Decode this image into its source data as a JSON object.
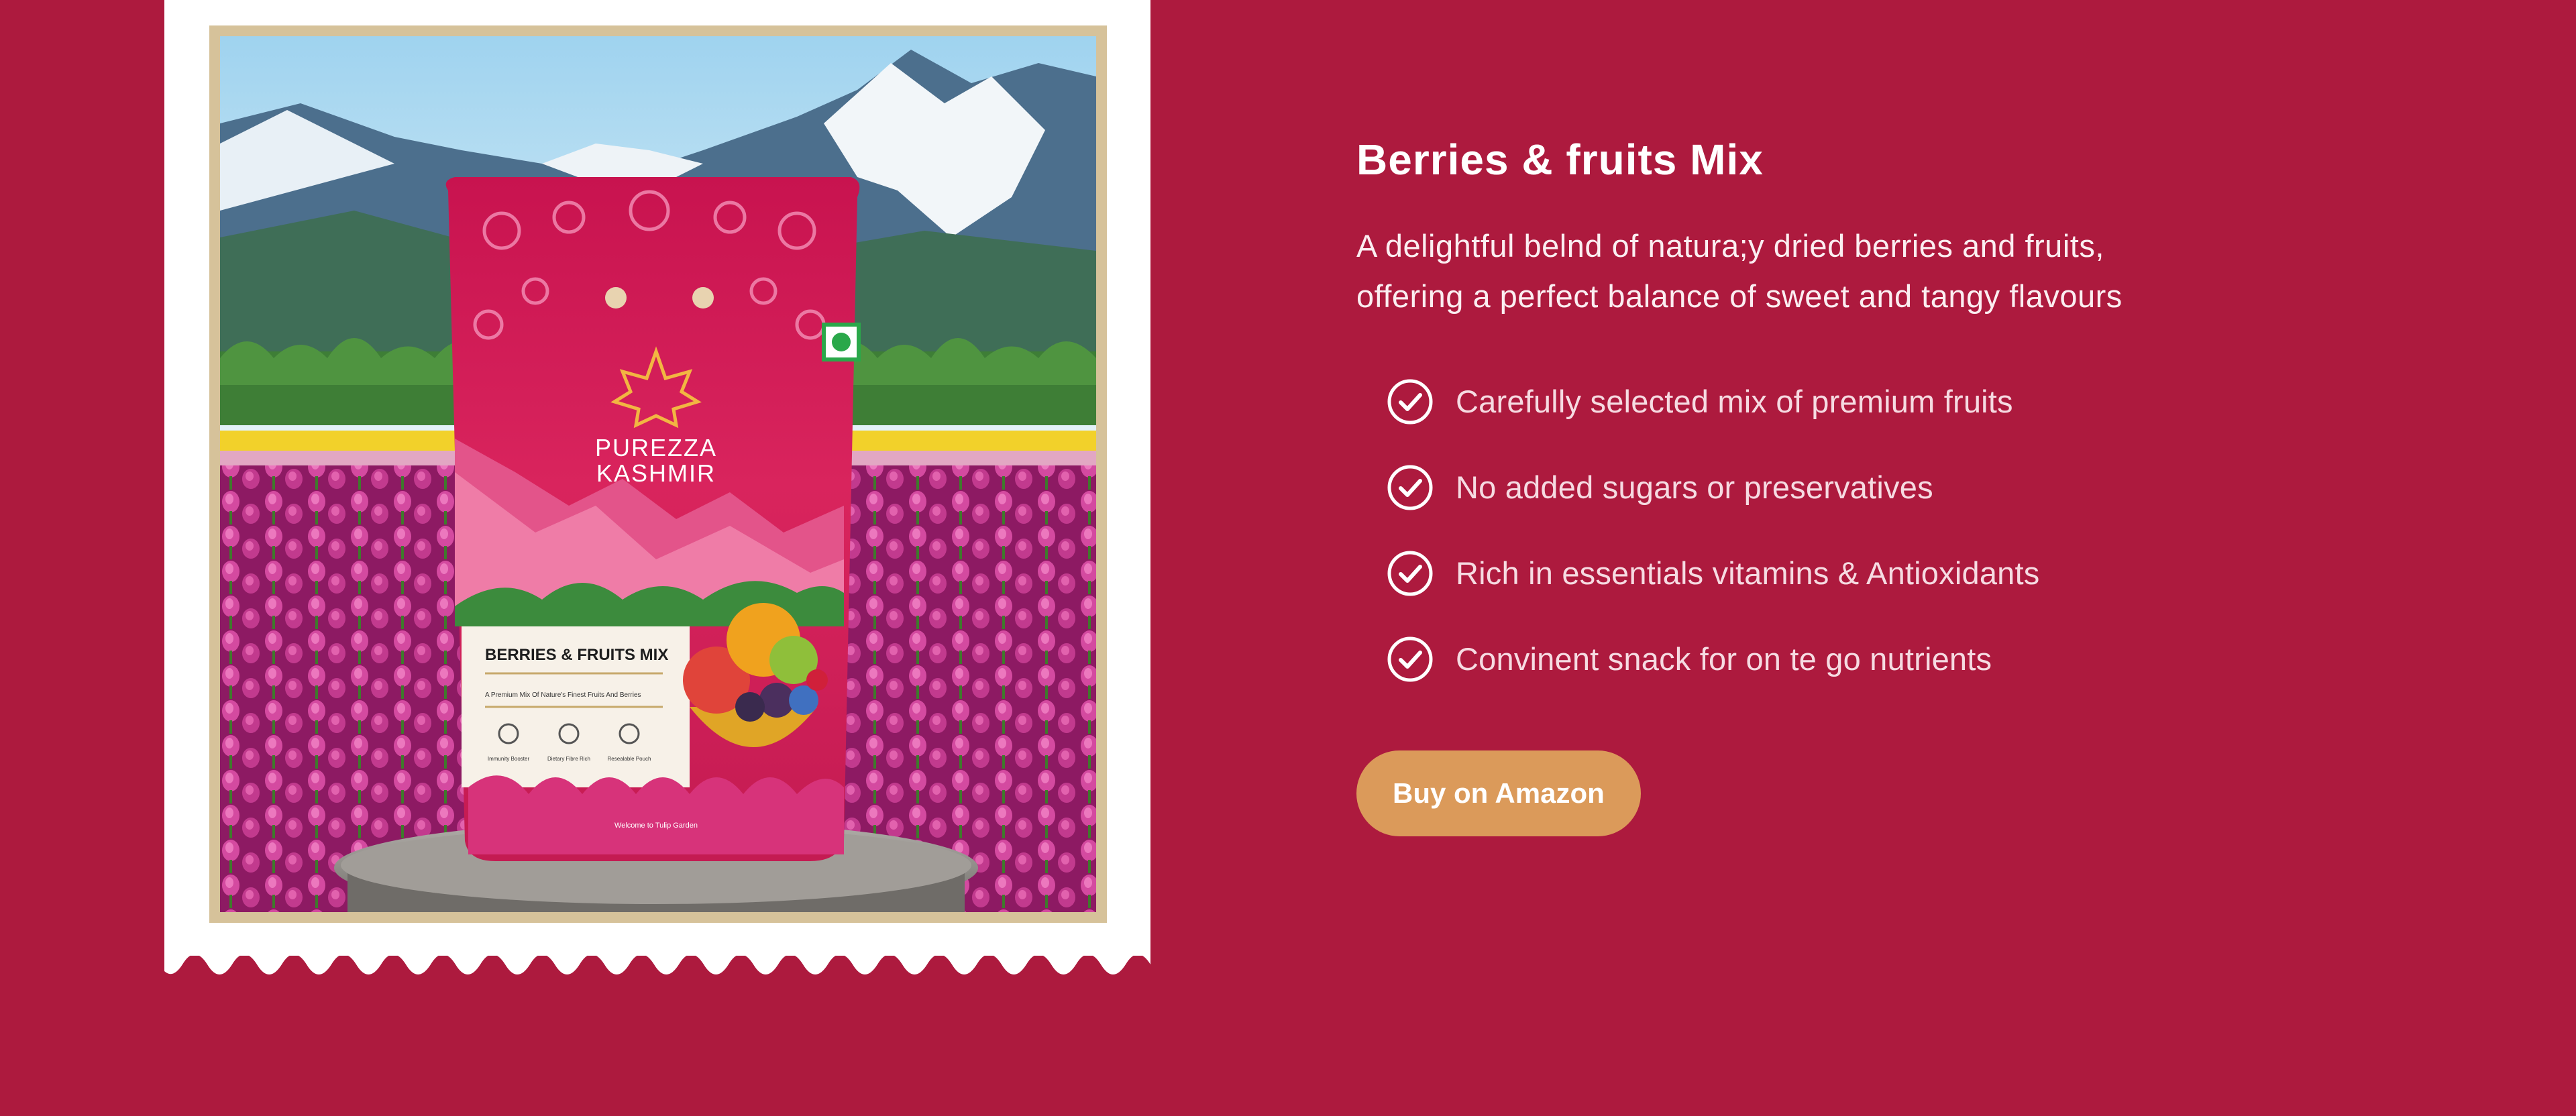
{
  "product": {
    "title": "Berries & fruits Mix",
    "description": "A delightful belnd of natura;y dried berries and fruits, offering a perfect balance of sweet and tangy flavours",
    "features": [
      "Carefully selected mix of premium fruits",
      "No added sugars or preservatives",
      "Rich in essentials vitamins & Antioxidants",
      "Convinent snack for on te go nutrients"
    ],
    "buy_label": "Buy on Amazon"
  },
  "package": {
    "brand_line1": "PUREZZA",
    "brand_line2": "KASHMIR",
    "name": "BERRIES & FRUITS MIX",
    "tagline": "A Premium Mix Of Nature's Finest Fruits And Berries",
    "badges": [
      "Immunity Booster",
      "Dietary Fibre Rich",
      "Resealable Pouch"
    ],
    "footer": "Welcome to Tulip Garden"
  },
  "colors": {
    "background": "#ad1a3e",
    "button": "#db9a5a",
    "frame": "#d6c29a"
  },
  "icons": {
    "feature_marker": "check-circle-icon"
  }
}
